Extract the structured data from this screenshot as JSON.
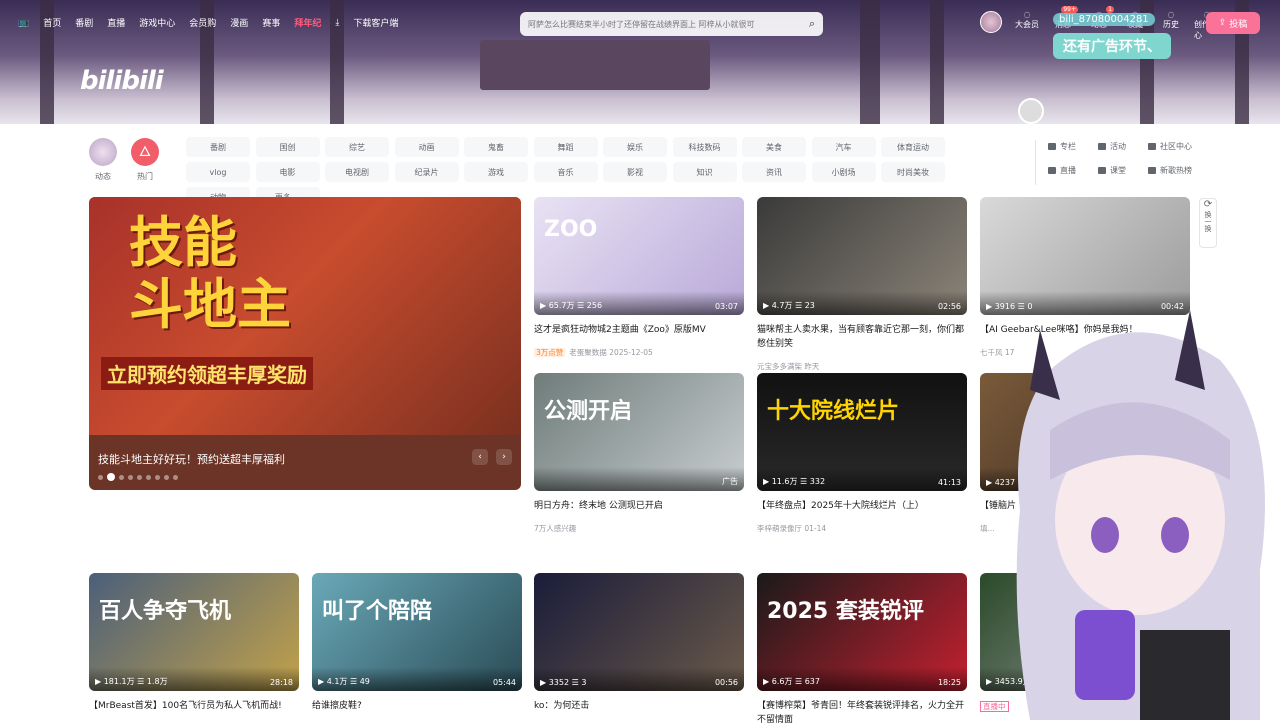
{
  "header": {
    "nav": [
      "首页",
      "番剧",
      "直播",
      "游戏中心",
      "会员购",
      "漫画",
      "赛事",
      "拜年纪",
      "下载客户端"
    ],
    "search_placeholder": "阿萨怎么比赛结束半小时了还停留在战绩界面上 阿梓从小就很可",
    "right_icons": [
      {
        "label": "大会员",
        "badge": ""
      },
      {
        "label": "消息",
        "badge": "99+"
      },
      {
        "label": "动态",
        "badge": "1"
      },
      {
        "label": "收藏",
        "badge": ""
      },
      {
        "label": "历史",
        "badge": ""
      },
      {
        "label": "创作中心",
        "badge": ""
      }
    ],
    "upload_label": "投稿",
    "logo": "bilibili"
  },
  "overlay": {
    "username": "bili_87080004281",
    "bubble": "还有广告环节、"
  },
  "channels": {
    "dynamic": "动态",
    "hot": "热门",
    "categories": [
      "番剧",
      "国创",
      "综艺",
      "动画",
      "鬼畜",
      "舞蹈",
      "娱乐",
      "科技数码",
      "美食",
      "汽车",
      "体育运动",
      "vlog",
      "电影",
      "电视剧",
      "纪录片",
      "游戏",
      "音乐",
      "影视",
      "知识",
      "资讯",
      "小剧场",
      "时尚美妆",
      "动物",
      "更多 ⌄"
    ],
    "links": [
      "专栏",
      "活动",
      "社区中心",
      "直播",
      "课堂",
      "新歌热榜"
    ]
  },
  "carousel": {
    "caption": "技能斗地主好好玩！预约送超丰厚福利",
    "headline": "技能\n斗地主",
    "subline": "立即预约领超丰厚奖励",
    "dots": 9,
    "active_dot": 1
  },
  "refresh_label": "换一换",
  "cards": [
    {
      "views": "65.7万",
      "danmaku": "256",
      "duration": "03:07",
      "title": "这才是疯狂动物城2主题曲《Zoo》原版MV",
      "tag": "3万点赞",
      "author": "老蛋聚数据",
      "date": "2025-12-05",
      "thumb_text": "ZOO",
      "bg": "linear-gradient(135deg,#e9e2f4,#b8a9d8)"
    },
    {
      "views": "4.7万",
      "danmaku": "23",
      "duration": "02:56",
      "title": "猫咪帮主人卖水果，当有顾客靠近它那一刻，你们都憋住别笑",
      "author": "元宝多多满柴",
      "date": "昨天",
      "thumb_text": "",
      "bg": "linear-gradient(135deg,#3a3a3a,#8b8478)"
    },
    {
      "views": "3916",
      "danmaku": "0",
      "duration": "00:42",
      "title": "【AI Geebar&Lee咪咯】你妈是我妈！",
      "author": "七千风",
      "date": "17",
      "thumb_text": "",
      "bg": "linear-gradient(135deg,#d9d9d9,#9c9c9c)"
    },
    {
      "views": "",
      "danmaku": "",
      "duration": "广告",
      "title": "明日方舟：终末地 公测现已开启",
      "author": "7万人感兴趣",
      "date": "",
      "thumb_text": "公测开启",
      "bg": "linear-gradient(135deg,#6f7c7a,#c8ced0)"
    },
    {
      "views": "11.6万",
      "danmaku": "332",
      "duration": "41:13",
      "title": "【年终盘点】2025年十大院线烂片（上）",
      "author": "李梓萌录像厅",
      "date": "01-14",
      "thumb_text": "十大院线烂片",
      "bg": "linear-gradient(180deg,#111,#2a2a2a)"
    },
    {
      "views": "4237",
      "danmaku": "",
      "duration": "",
      "title": "【锤脑片",
      "author": "填...",
      "date": "",
      "thumb_text": "",
      "bg": "linear-gradient(135deg,#7a5a3a,#3a2a20)"
    },
    {
      "views": "181.1万",
      "danmaku": "1.8万",
      "duration": "28:18",
      "title": "【MrBeast首发】100名飞行员为私人飞机而战!",
      "author": "",
      "date": "",
      "thumb_text": "百人争夺飞机",
      "bg": "linear-gradient(135deg,#4b5f7a,#c2a24a)"
    },
    {
      "views": "4.1万",
      "danmaku": "49",
      "duration": "05:44",
      "title": "给谁擦皮鞋?",
      "author": "",
      "date": "",
      "thumb_text": "叫了个陪陪",
      "bg": "linear-gradient(135deg,#6aa9b8,#2a4b56)"
    },
    {
      "views": "3352",
      "danmaku": "3",
      "duration": "00:56",
      "title": "ko：为何还击",
      "author": "",
      "date": "",
      "thumb_text": "",
      "bg": "linear-gradient(135deg,#1a1c3a,#6b5a4a)"
    },
    {
      "views": "6.6万",
      "danmaku": "637",
      "duration": "18:25",
      "title": "【赛博榨菜】爷青回！年终套装锐评排名，火力全开不留情面",
      "author": "",
      "date": "",
      "thumb_text": "2025 套装锐评",
      "bg": "linear-gradient(135deg,#1a1a1a,#c42030)"
    },
    {
      "views": "3453.9万",
      "danmaku": "",
      "duration": "",
      "title": "",
      "author": "",
      "date": "",
      "live": "直播中",
      "thumb_text": "",
      "bg": "linear-gradient(135deg,#2a4a2a,#9a9a9a)"
    }
  ]
}
